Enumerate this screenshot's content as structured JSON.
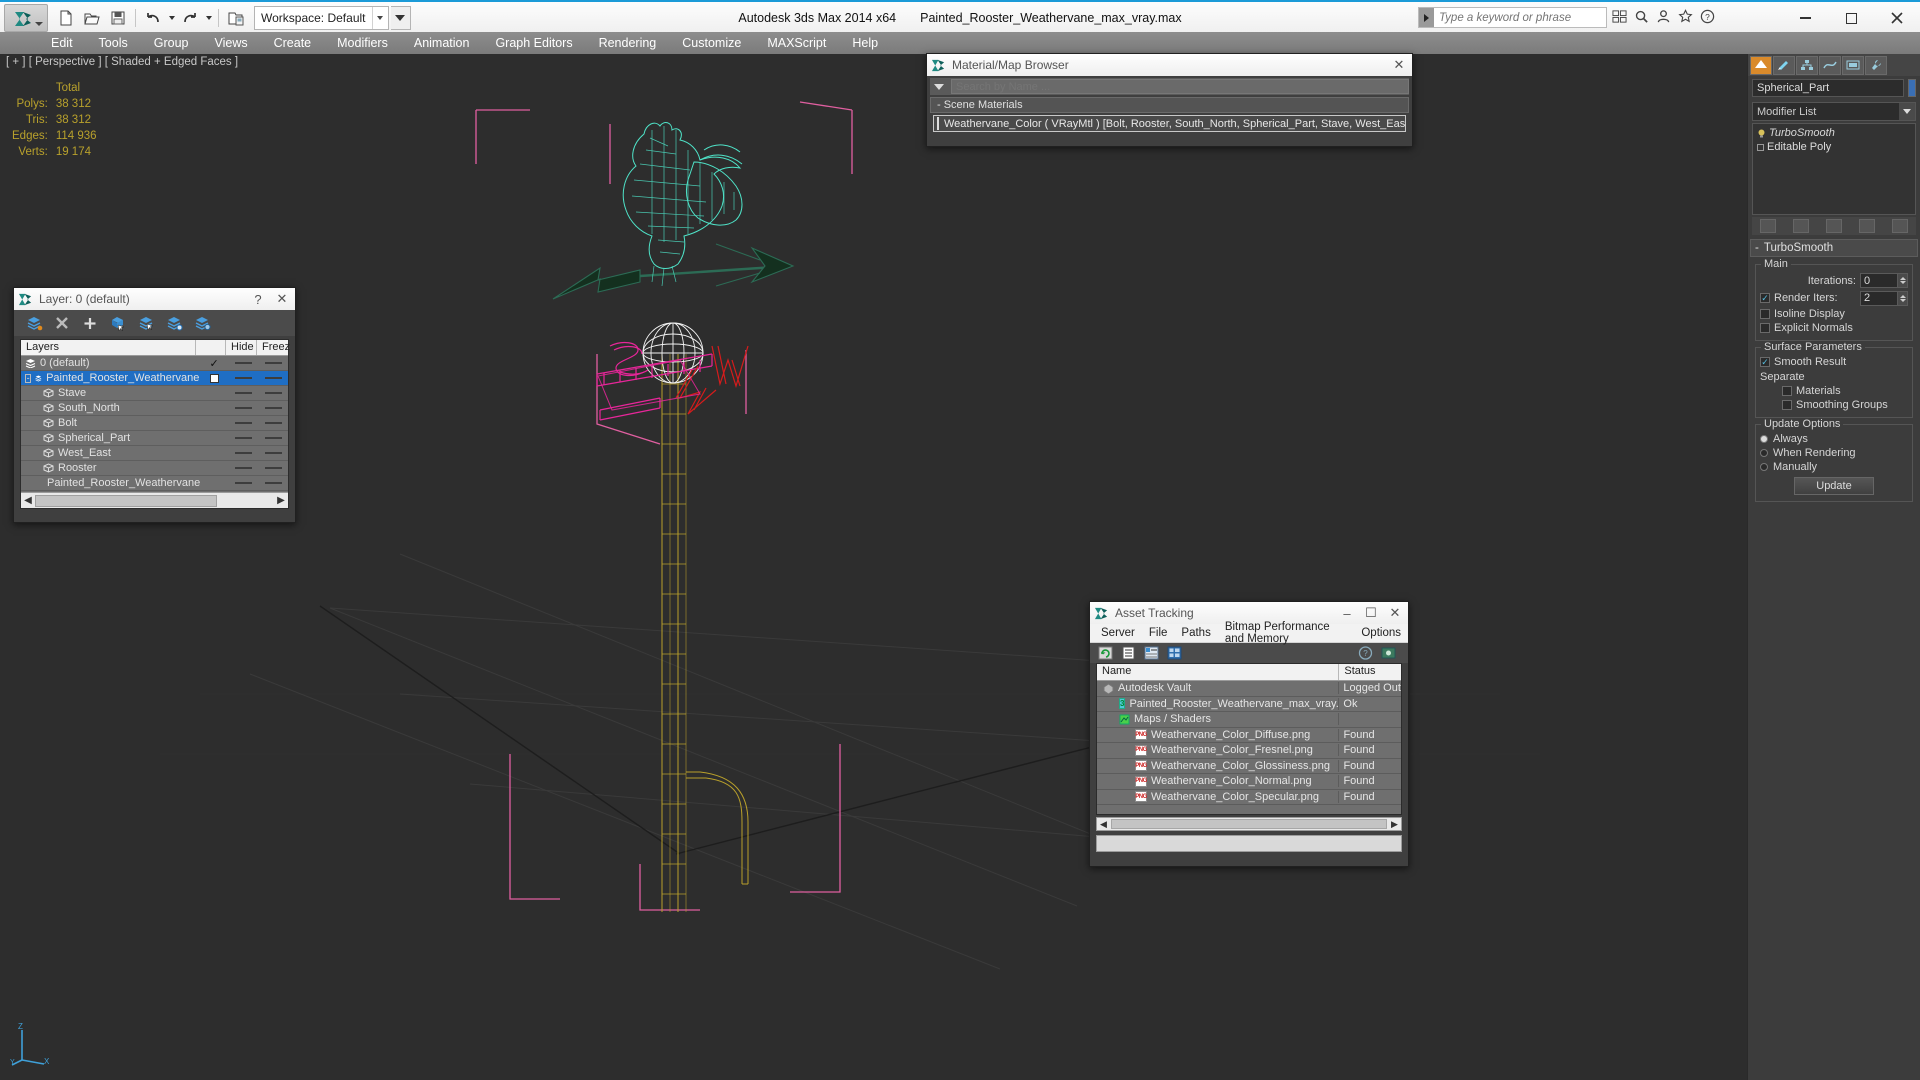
{
  "app": {
    "title": "Autodesk 3ds Max  2014 x64",
    "file": "Painted_Rooster_Weathervane_max_vray.max",
    "workspace": "Workspace: Default"
  },
  "search": {
    "placeholder": "Type a keyword or phrase"
  },
  "menu": {
    "items": [
      "Edit",
      "Tools",
      "Group",
      "Views",
      "Create",
      "Modifiers",
      "Animation",
      "Graph Editors",
      "Rendering",
      "Customize",
      "MAXScript",
      "Help"
    ]
  },
  "window_controls": {
    "minimize": "–",
    "maximize": "☐",
    "close": "✕"
  },
  "viewport": {
    "label": "[ + ] [ Perspective ] [ Shaded + Edged Faces ]",
    "stats_header": "Total",
    "stats": [
      {
        "label": "Polys:",
        "value": "38 312"
      },
      {
        "label": "Tris:",
        "value": "38 312"
      },
      {
        "label": "Edges:",
        "value": "114 936"
      },
      {
        "label": "Verts:",
        "value": "19 174"
      }
    ],
    "axis": {
      "z": "Z",
      "x": "X",
      "y": "Y"
    }
  },
  "layer_window": {
    "title": "Layer: 0 (default)",
    "help_label": "?",
    "close_label": "✕",
    "columns": {
      "name": "Layers",
      "hide": "Hide",
      "freeze": "Freez"
    },
    "rows": [
      {
        "name": "0 (default)",
        "type": "layer",
        "indent": 0,
        "selected": false,
        "check": true,
        "box": false
      },
      {
        "name": "Painted_Rooster_Weathervane",
        "type": "layer",
        "indent": 0,
        "selected": true,
        "check": false,
        "box": true,
        "expander": "-"
      },
      {
        "name": "Stave",
        "type": "object",
        "indent": 1,
        "selected": false
      },
      {
        "name": "South_North",
        "type": "object",
        "indent": 1,
        "selected": false
      },
      {
        "name": "Bolt",
        "type": "object",
        "indent": 1,
        "selected": false
      },
      {
        "name": "Spherical_Part",
        "type": "object",
        "indent": 1,
        "selected": false
      },
      {
        "name": "West_East",
        "type": "object",
        "indent": 1,
        "selected": false
      },
      {
        "name": "Rooster",
        "type": "object",
        "indent": 1,
        "selected": false
      },
      {
        "name": "Painted_Rooster_Weathervane",
        "type": "object",
        "indent": 1,
        "selected": false
      }
    ]
  },
  "material_browser": {
    "title": "Material/Map Browser",
    "close_label": "✕",
    "search_placeholder": "Search by Name ...",
    "section": "-  Scene Materials",
    "items": [
      {
        "name": "Weathervane_Color  ( VRayMtl )  [Bolt, Rooster, South_North, Spherical_Part, Stave, West_East]"
      }
    ]
  },
  "asset_tracking": {
    "title": "Asset Tracking",
    "minimize": "–",
    "maximize": "☐",
    "close": "✕",
    "menu": [
      "Server",
      "File",
      "Paths",
      "Bitmap Performance and Memory",
      "Options"
    ],
    "columns": {
      "name": "Name",
      "status": "Status"
    },
    "rows": [
      {
        "name": "Autodesk Vault",
        "status": "Logged Out",
        "indent": 0,
        "icon": "vault-icon"
      },
      {
        "name": "Painted_Rooster_Weathervane_max_vray.max",
        "status": "Ok",
        "indent": 1,
        "icon": "max-file-icon"
      },
      {
        "name": "Maps / Shaders",
        "status": "",
        "indent": 1,
        "icon": "maps-icon"
      },
      {
        "name": "Weathervane_Color_Diffuse.png",
        "status": "Found",
        "indent": 2,
        "icon": "png-icon"
      },
      {
        "name": "Weathervane_Color_Fresnel.png",
        "status": "Found",
        "indent": 2,
        "icon": "png-icon"
      },
      {
        "name": "Weathervane_Color_Glossiness.png",
        "status": "Found",
        "indent": 2,
        "icon": "png-icon"
      },
      {
        "name": "Weathervane_Color_Normal.png",
        "status": "Found",
        "indent": 2,
        "icon": "png-icon"
      },
      {
        "name": "Weathervane_Color_Specular.png",
        "status": "Found",
        "indent": 2,
        "icon": "png-icon"
      }
    ]
  },
  "command_panel": {
    "object_name": "Spherical_Part",
    "object_color": "#3a6fb5",
    "modifier_list_label": "Modifier List",
    "stack": [
      {
        "label": "TurboSmooth",
        "italic": true
      },
      {
        "label": "Editable Poly",
        "italic": false
      }
    ],
    "rollout_title": "TurboSmooth",
    "groups": {
      "main": {
        "label": "Main",
        "iterations_label": "Iterations:",
        "iterations_value": "0",
        "render_iters_label": "Render Iters:",
        "render_iters_value": "2",
        "render_iters_checked": true,
        "isoline_display": "Isoline Display",
        "explicit_normals": "Explicit Normals"
      },
      "surface": {
        "label": "Surface Parameters",
        "smooth_result": "Smooth Result",
        "smooth_result_checked": true,
        "separate_label": "Separate",
        "materials": "Materials",
        "smoothing_groups": "Smoothing Groups"
      },
      "update": {
        "label": "Update Options",
        "options": [
          "Always",
          "When Rendering",
          "Manually"
        ],
        "selected": "Always",
        "button": "Update"
      }
    }
  }
}
